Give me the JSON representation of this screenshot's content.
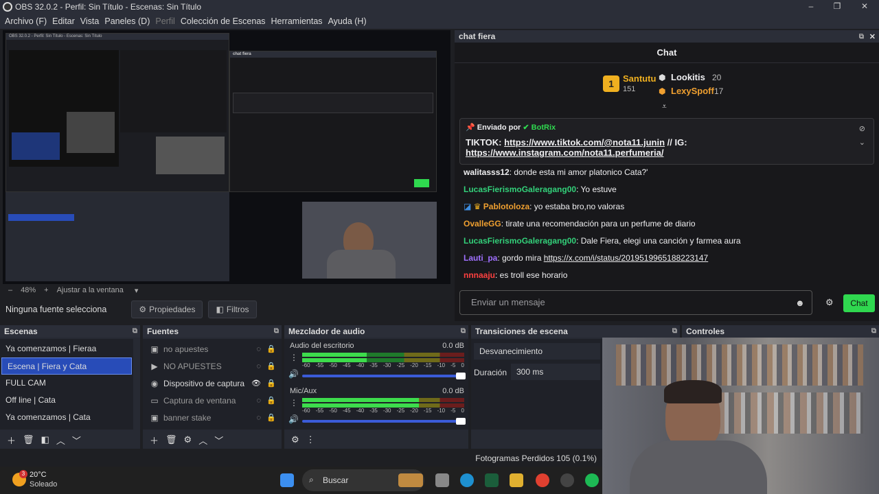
{
  "window": {
    "title": "OBS 32.0.2 - Perfil: Sin Título - Escenas: Sin Título",
    "minimize": "–",
    "maximize": "❐",
    "close": "✕"
  },
  "menu": {
    "items": [
      "Archivo (F)",
      "Editar",
      "Vista",
      "Paneles (D)",
      "Perfil",
      "Colección de Escenas",
      "Herramientas",
      "Ayuda (H)"
    ]
  },
  "zoombar": {
    "minus": "–",
    "zoom": "48%",
    "plus": "+",
    "fit": "Ajustar a la ventana"
  },
  "sourcebar": {
    "no_source": "Ninguna fuente selecciona",
    "properties": "Propiedades",
    "filters": "Filtros"
  },
  "chat": {
    "dock_title": "chat fiera",
    "title": "Chat",
    "leaders": [
      {
        "rank": "1",
        "name": "Santutu",
        "count": "151"
      },
      {
        "name": "Lookitis",
        "count": "20"
      },
      {
        "name": "LexySpoff",
        "count": "17"
      }
    ],
    "pinned": {
      "sent_by": "Enviado por",
      "author": "BotRix",
      "text_a": "TIKTOK: ",
      "link1": "https://www.tiktok.com/@nota11.junin",
      "text_b": " // IG:",
      "link2": "https://www.instagram.com/nota11.perfumeria/"
    },
    "messages": [
      {
        "user": "walitasss12",
        "color": "#efeff1",
        "text": ": donde esta mi amor platonico Cata?'"
      },
      {
        "user": "LucasFierismoGaleragang00",
        "color": "#33d17a",
        "text": ": Yo estuve"
      },
      {
        "user": "Pablotoloza",
        "color": "#f0a030",
        "text": ": yo estaba bro,no valoras"
      },
      {
        "user": "OvalleGG",
        "color": "#f0a030",
        "text": ": tirate una recomendación para un perfume de diario"
      },
      {
        "user": "LucasFierismoGaleragang00",
        "color": "#33d17a",
        "text": ": Dale Fiera, elegi una canción y farmea aura"
      },
      {
        "user": "Lauti_pa",
        "color": "#a070ff",
        "text": ": gordo mira ",
        "link": "https://x.com/i/status/2019519965188223147"
      },
      {
        "user": "nnnaaju",
        "color": "#ff4040",
        "text": ": es troll ese horario"
      }
    ],
    "input_placeholder": "Enviar un mensaje",
    "send_button": "Chat"
  },
  "docks": {
    "scenes": {
      "title": "Escenas",
      "items": [
        "Ya comenzamos | Fieraa",
        "Escena | Fiera y Cata",
        "FULL CAM",
        "Off line | Cata",
        "Ya comenzamos | Cata"
      ],
      "selected": "Escena | Fiera y Cata"
    },
    "sources": {
      "title": "Fuentes",
      "items": [
        "no apuestes",
        "NO APUESTES",
        "Dispositivo de captura",
        "Captura de ventana",
        "banner stake"
      ]
    },
    "mixer": {
      "title": "Mezclador de audio",
      "channels": [
        {
          "name": "Audio del escritorio",
          "db": "0.0 dB",
          "level": 0.4
        },
        {
          "name": "Mic/Aux",
          "db": "0.0 dB",
          "level": 0.72
        }
      ],
      "ticks": [
        "-60",
        "-55",
        "-50",
        "-45",
        "-40",
        "-35",
        "-30",
        "-25",
        "-20",
        "-15",
        "-10",
        "-5",
        "0"
      ]
    },
    "transitions": {
      "title": "Transiciones de escena",
      "transition": "Desvanecimiento",
      "duration_label": "Duración",
      "duration": "300 ms"
    },
    "controls": {
      "title": "Controles"
    }
  },
  "status": {
    "dropped_frames": "Fotogramas Perdidos 105 (0.1%)"
  },
  "taskbar": {
    "weather_badge": "3",
    "temp": "20°C",
    "condition": "Soleado",
    "search": "Buscar"
  },
  "nested_preview": {
    "title": "OBS 32.0.2 - Perfil: Sin Título - Escenas: Sin Título",
    "chat_title": "chat fiera"
  }
}
